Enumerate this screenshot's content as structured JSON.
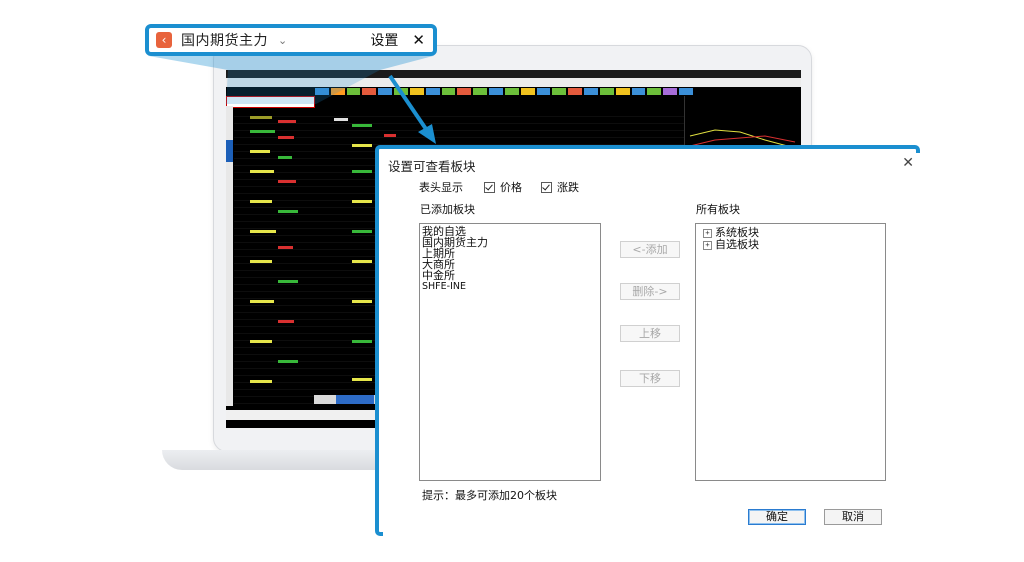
{
  "callout": {
    "back_icon": "chevron-left-icon",
    "title": "国内期货主力",
    "dropdown_icon": "chevron-down-icon",
    "settings_label": "设置",
    "close_label": "✕"
  },
  "dialog": {
    "title": "设置可查看板块",
    "close_label": "✕",
    "header_display_label": "表头显示",
    "checkbox_price_label": "价格",
    "checkbox_change_label": "涨跌",
    "added_label": "已添加板块",
    "all_label": "所有板块",
    "added_items": [
      "我的自选",
      "国内期货主力",
      "上期所",
      "大商所",
      "中金所",
      "SHFE-INE"
    ],
    "tree_items": [
      "系统板块",
      "自选板块"
    ],
    "add_button": "<-添加",
    "remove_button": "删除->",
    "up_button": "上移",
    "down_button": "下移",
    "hint": "提示：最多可添加20个板块",
    "ok_button": "确定",
    "cancel_button": "取消"
  },
  "colors": {
    "accent": "#1b8fd0",
    "back_button": "#e8633c"
  }
}
